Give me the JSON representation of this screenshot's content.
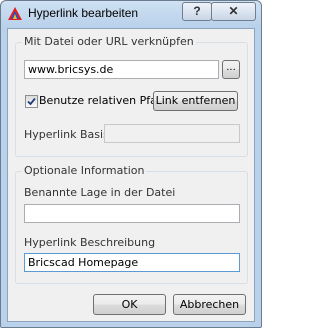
{
  "window": {
    "title": "Hyperlink bearbeiten",
    "help_label": "?",
    "close_label": "✕"
  },
  "link_group": {
    "label": "Mit Datei oder URL verknüpfen",
    "url_value": "www.bricsys.de",
    "browse_label": "...",
    "relative_path_label": "Benutze relativen Pfad",
    "relative_path_checked": true,
    "remove_link_label": "Link entfernen",
    "base_label": "Hyperlink Basis:",
    "base_value": ""
  },
  "optional_group": {
    "label": "Optionale Information",
    "location_label": "Benannte Lage in der Datei",
    "location_value": "",
    "description_label": "Hyperlink Beschreibung",
    "description_value": "Bricscad Homepage"
  },
  "footer": {
    "ok_label": "OK",
    "cancel_label": "Abbrechen"
  }
}
